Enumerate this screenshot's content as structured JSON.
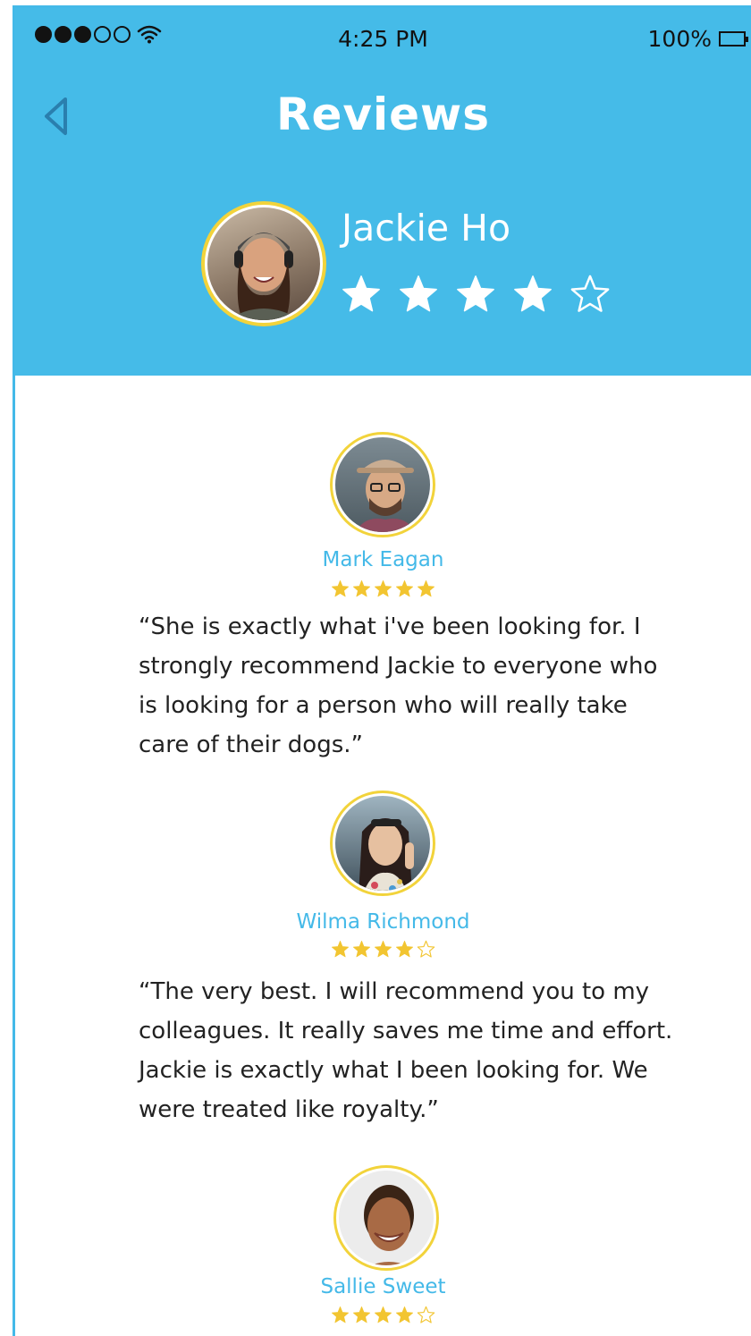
{
  "status_bar": {
    "signal_dots_filled": 3,
    "signal_dots_total": 5,
    "time": "4:25 PM",
    "battery_percent": "100%"
  },
  "header": {
    "title": "Reviews",
    "back_icon": "chevron-left-icon"
  },
  "profile": {
    "name": "Jackie Ho",
    "rating": 4,
    "rating_max": 5
  },
  "reviews": [
    {
      "name": "Mark Eagan",
      "rating": 5,
      "rating_max": 5,
      "text": "“She is exactly what i've been looking for. I strongly recommend Jackie to everyone who is looking for a person who will really take care of their dogs.”"
    },
    {
      "name": "Wilma Richmond",
      "rating": 4,
      "rating_max": 5,
      "text": "“The very best. I will recommend you to my colleagues. It really saves me time and effort. Jackie is exactly what I been looking for. We were treated like royalty.”"
    },
    {
      "name": "Sallie Sweet",
      "rating": 4,
      "rating_max": 5,
      "text": ""
    }
  ],
  "colors": {
    "header_bg": "#45bbe8",
    "accent": "#44b9e8",
    "star_gold": "#f2c531",
    "avatar_ring": "#f2d33b"
  }
}
